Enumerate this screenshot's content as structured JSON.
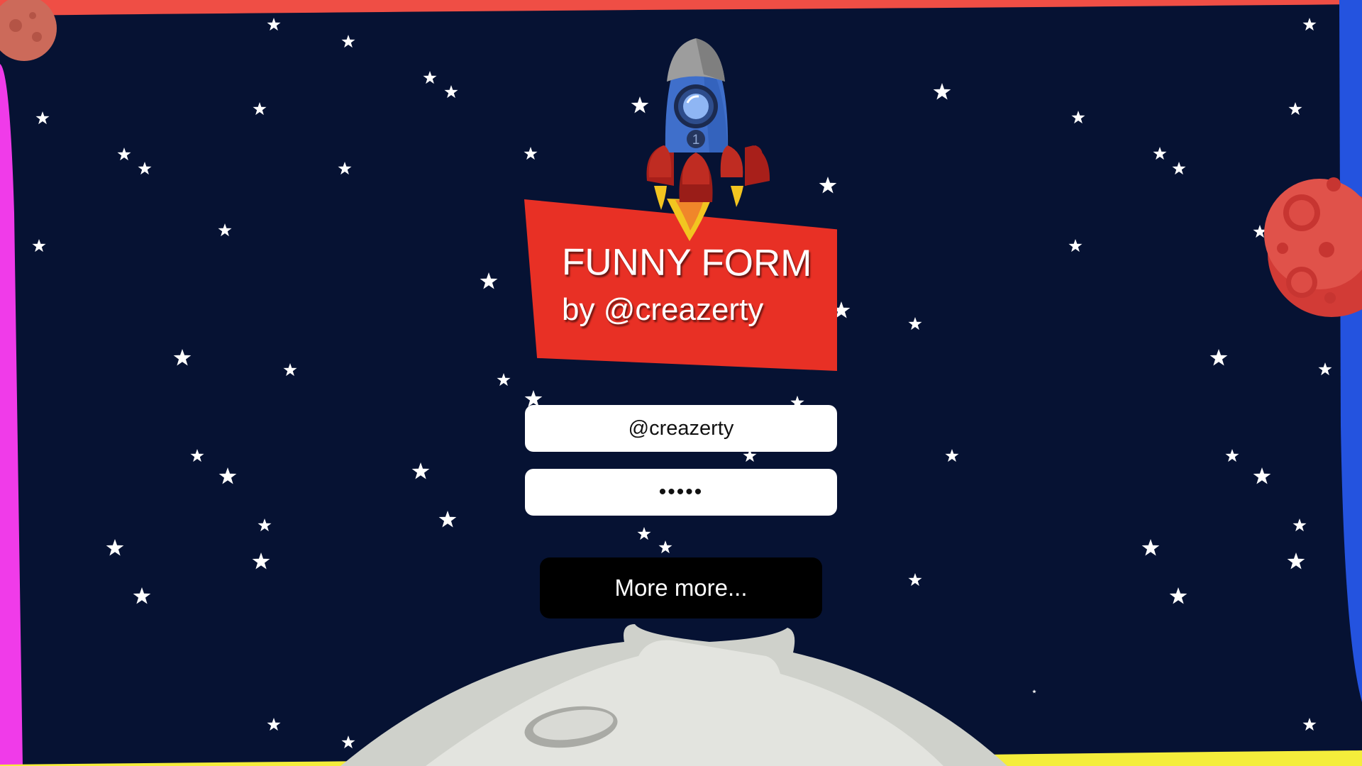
{
  "theme": {
    "background": "#061233",
    "banner_color": "#e83025",
    "button_color": "#000000",
    "star_color": "#ffffff",
    "top_border_color": "#ef4e45",
    "left_border_color": "#f03be9",
    "right_border_color": "#2453df",
    "bottom_border_color": "#f4ed3b"
  },
  "header": {
    "title": "FUNNY FORM",
    "subtitle": "by @creazerty"
  },
  "form": {
    "username_value": "@creazerty",
    "password_value": "•••••",
    "submit_label": "More more..."
  },
  "icons": {
    "rocket": "rocket-icon",
    "rocket_number": "1",
    "moon": "moon-icon",
    "planet_right": "red-planet-icon",
    "planet_top_left": "small-planet-icon",
    "stars": "star-icon"
  }
}
